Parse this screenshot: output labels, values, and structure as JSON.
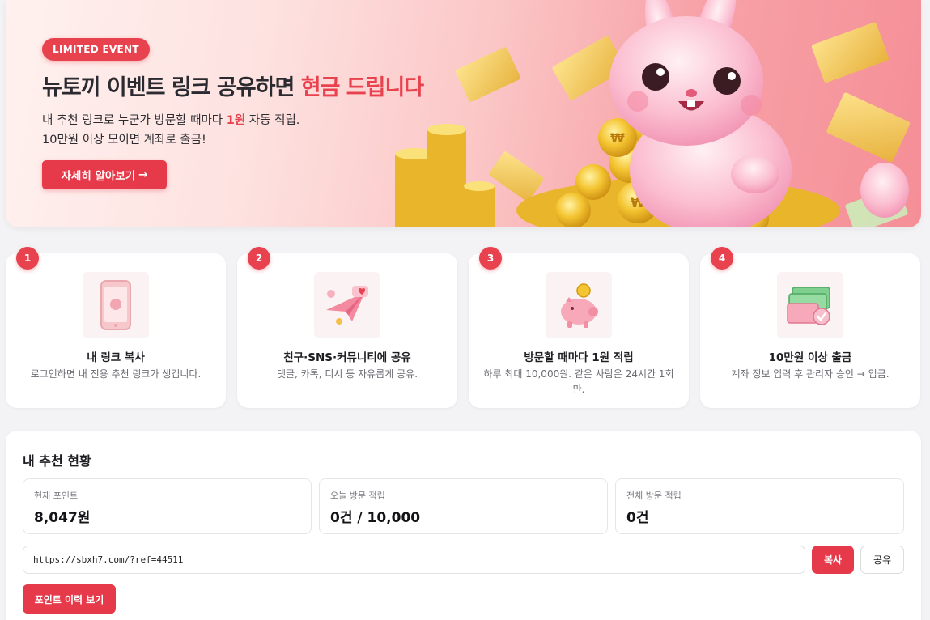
{
  "hero": {
    "badge": "LIMITED EVENT",
    "title_part1": "뉴토끼 이벤트  링크 공유하면 ",
    "title_accent": "현금 드립니다",
    "desc_line1_pre": "내 추천 링크로 누군가 방문할 때마다 ",
    "desc_line1_hl": "1원",
    "desc_line1_post": " 자동 적립.",
    "desc_line2": "10만원 이상 모이면 계좌로 출금!",
    "cta_label": "자세히 알아보기",
    "cta_arrow": "→"
  },
  "steps": [
    {
      "num": "1",
      "title": "내 링크 복사",
      "desc": "로그인하면 내 전용 추천 링크가 생깁니다.",
      "icon": "phone-icon"
    },
    {
      "num": "2",
      "title": "친구·SNS·커뮤니티에 공유",
      "desc": "댓글, 카톡, 디시 등 자유롭게 공유.",
      "icon": "paper-plane-icon"
    },
    {
      "num": "3",
      "title": "방문할 때마다 1원 적립",
      "desc": "하루 최대 10,000원. 같은 사람은 24시간 1회만.",
      "icon": "piggy-bank-icon"
    },
    {
      "num": "4",
      "title": "10만원 이상 출금",
      "desc": "계좌 정보 입력 후 관리자 승인 → 입금.",
      "icon": "cash-icon"
    }
  ],
  "status": {
    "title": "내 추천 현황",
    "stats": [
      {
        "label": "현재 포인트",
        "value": "8,047원"
      },
      {
        "label": "오늘 방문 적립",
        "value": "0건 / 10,000"
      },
      {
        "label": "전체 방문 적립",
        "value": "0건"
      }
    ],
    "ref_link": "https://sbxh7.com/?ref=44511",
    "copy_label": "복사",
    "share_label": "공유",
    "history_label": "포인트 이력 보기"
  },
  "colors": {
    "accent": "#e8424f",
    "hero_bg": "#f9b7b9"
  }
}
